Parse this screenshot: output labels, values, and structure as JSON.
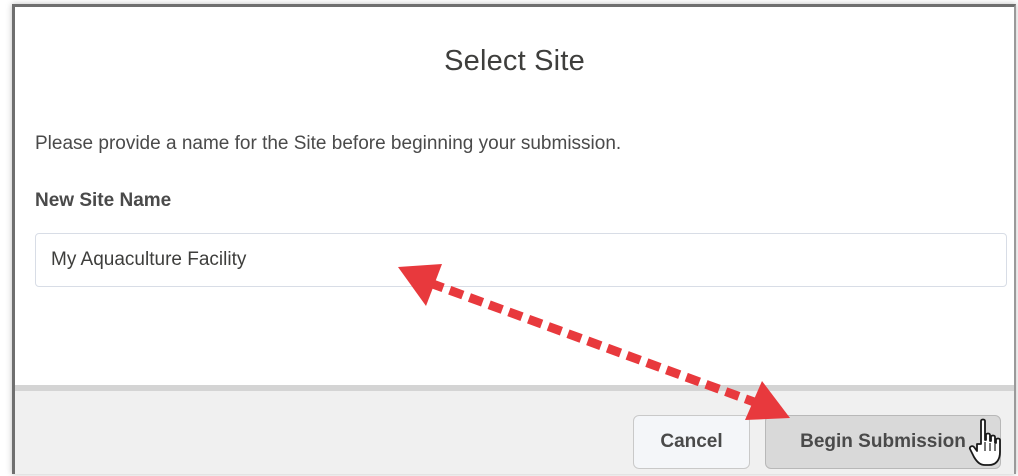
{
  "dialog": {
    "title": "Select Site",
    "instructions": "Please provide a name for the Site before beginning your submission.",
    "field_label": "New Site Name",
    "field_value": "My Aquaculture Facility"
  },
  "footer": {
    "cancel_label": "Cancel",
    "submit_label": "Begin Submission"
  },
  "annotation": {
    "arrow_color": "#e8393d",
    "arrow_icon": "double-headed-dashed-arrow",
    "cursor_icon": "hand-pointer-icon"
  }
}
